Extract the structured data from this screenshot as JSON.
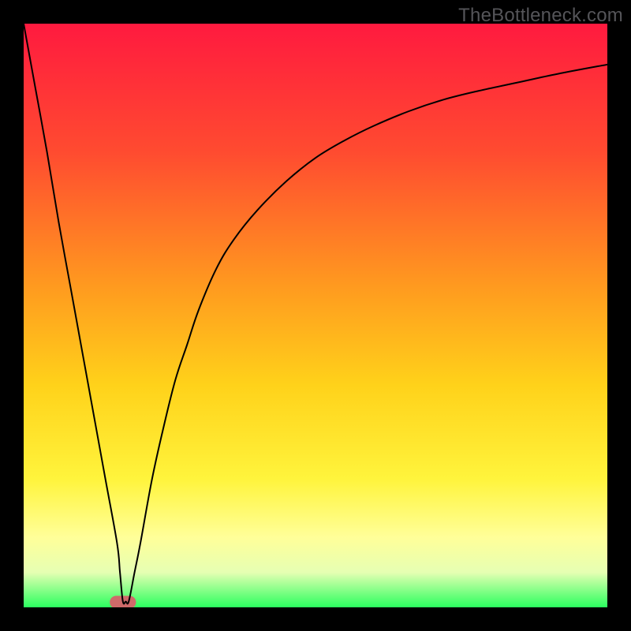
{
  "watermark": "TheBottleneck.com",
  "chart_data": {
    "type": "line",
    "title": "",
    "xlabel": "",
    "ylabel": "",
    "xlim": [
      0,
      100
    ],
    "ylim": [
      0,
      100
    ],
    "background_gradient": {
      "stops": [
        {
          "offset": 0,
          "color": "#ff1a3f"
        },
        {
          "offset": 0.22,
          "color": "#ff4b30"
        },
        {
          "offset": 0.45,
          "color": "#ff9a1f"
        },
        {
          "offset": 0.62,
          "color": "#ffd21a"
        },
        {
          "offset": 0.78,
          "color": "#fff43c"
        },
        {
          "offset": 0.88,
          "color": "#ffff99"
        },
        {
          "offset": 0.94,
          "color": "#e6ffb3"
        },
        {
          "offset": 1.0,
          "color": "#2bff5f"
        }
      ]
    },
    "series": [
      {
        "name": "bottleneck-curve",
        "color": "#000000",
        "x": [
          0,
          2,
          4,
          6,
          8,
          10,
          12,
          14,
          16,
          16.5,
          17,
          17.5,
          18,
          19,
          20,
          22,
          24,
          26,
          28,
          30,
          33,
          36,
          40,
          45,
          50,
          55,
          60,
          66,
          72,
          78,
          85,
          92,
          100
        ],
        "y": [
          100,
          89,
          78,
          66,
          55,
          44,
          33,
          22,
          11,
          6,
          1,
          1,
          1,
          6,
          11,
          22,
          31,
          39,
          45,
          51,
          58,
          63,
          68,
          73,
          77,
          80,
          82.5,
          85,
          87,
          88.5,
          90,
          91.5,
          93
        ]
      }
    ],
    "marker": {
      "name": "optimum-marker",
      "x": 17,
      "y": 0,
      "width": 4.5,
      "height": 2.2,
      "color": "#cf6a6a"
    }
  }
}
